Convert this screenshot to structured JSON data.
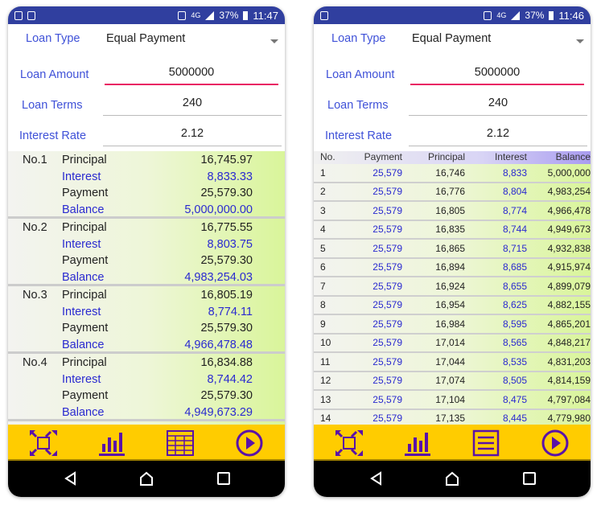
{
  "colors": {
    "status_bar": "#303f9f",
    "label": "#3f51d8",
    "toolbar": "#ffcc00",
    "icon": "#5a12a8"
  },
  "phones": [
    {
      "status": {
        "network": "4G",
        "battery": "37%",
        "time": "11:47"
      },
      "form": {
        "loan_type_label": "Loan Type",
        "loan_type_value": "Equal Payment",
        "amount_label": "Loan Amount",
        "amount_value": "5000000",
        "terms_label": "Loan Terms",
        "terms_value": "240",
        "rate_label": "Interest Rate",
        "rate_value": "2.12"
      },
      "keys": [
        "Principal",
        "Interest",
        "Payment",
        "Balance"
      ],
      "blocks": [
        {
          "no": "No.1",
          "values": [
            "16,745.97",
            "8,833.33",
            "25,579.30",
            "5,000,000.00"
          ]
        },
        {
          "no": "No.2",
          "values": [
            "16,775.55",
            "8,803.75",
            "25,579.30",
            "4,983,254.03"
          ]
        },
        {
          "no": "No.3",
          "values": [
            "16,805.19",
            "8,774.11",
            "25,579.30",
            "4,966,478.48"
          ]
        },
        {
          "no": "No.4",
          "values": [
            "16,834.88",
            "8,744.42",
            "25,579.30",
            "4,949,673.29"
          ]
        }
      ],
      "toolbar": [
        "fullscreen-icon",
        "bar-chart-icon",
        "table-icon",
        "play-icon"
      ]
    },
    {
      "status": {
        "network": "4G",
        "battery": "37%",
        "time": "11:46"
      },
      "form": {
        "loan_type_label": "Loan Type",
        "loan_type_value": "Equal Payment",
        "amount_label": "Loan Amount",
        "amount_value": "5000000",
        "terms_label": "Loan Terms",
        "terms_value": "240",
        "rate_label": "Interest Rate",
        "rate_value": "2.12"
      },
      "table": {
        "headers": [
          "No.",
          "Payment",
          "Principal",
          "Interest",
          "Balance"
        ],
        "rows": [
          [
            "1",
            "25,579",
            "16,746",
            "8,833",
            "5,000,000"
          ],
          [
            "2",
            "25,579",
            "16,776",
            "8,804",
            "4,983,254"
          ],
          [
            "3",
            "25,579",
            "16,805",
            "8,774",
            "4,966,478"
          ],
          [
            "4",
            "25,579",
            "16,835",
            "8,744",
            "4,949,673"
          ],
          [
            "5",
            "25,579",
            "16,865",
            "8,715",
            "4,932,838"
          ],
          [
            "6",
            "25,579",
            "16,894",
            "8,685",
            "4,915,974"
          ],
          [
            "7",
            "25,579",
            "16,924",
            "8,655",
            "4,899,079"
          ],
          [
            "8",
            "25,579",
            "16,954",
            "8,625",
            "4,882,155"
          ],
          [
            "9",
            "25,579",
            "16,984",
            "8,595",
            "4,865,201"
          ],
          [
            "10",
            "25,579",
            "17,014",
            "8,565",
            "4,848,217"
          ],
          [
            "11",
            "25,579",
            "17,044",
            "8,535",
            "4,831,203"
          ],
          [
            "12",
            "25,579",
            "17,074",
            "8,505",
            "4,814,159"
          ],
          [
            "13",
            "25,579",
            "17,104",
            "8,475",
            "4,797,084"
          ],
          [
            "14",
            "25,579",
            "17,135",
            "8,445",
            "4,779,980"
          ]
        ]
      },
      "toolbar": [
        "fullscreen-icon",
        "bar-chart-icon",
        "list-icon",
        "play-icon"
      ]
    }
  ]
}
